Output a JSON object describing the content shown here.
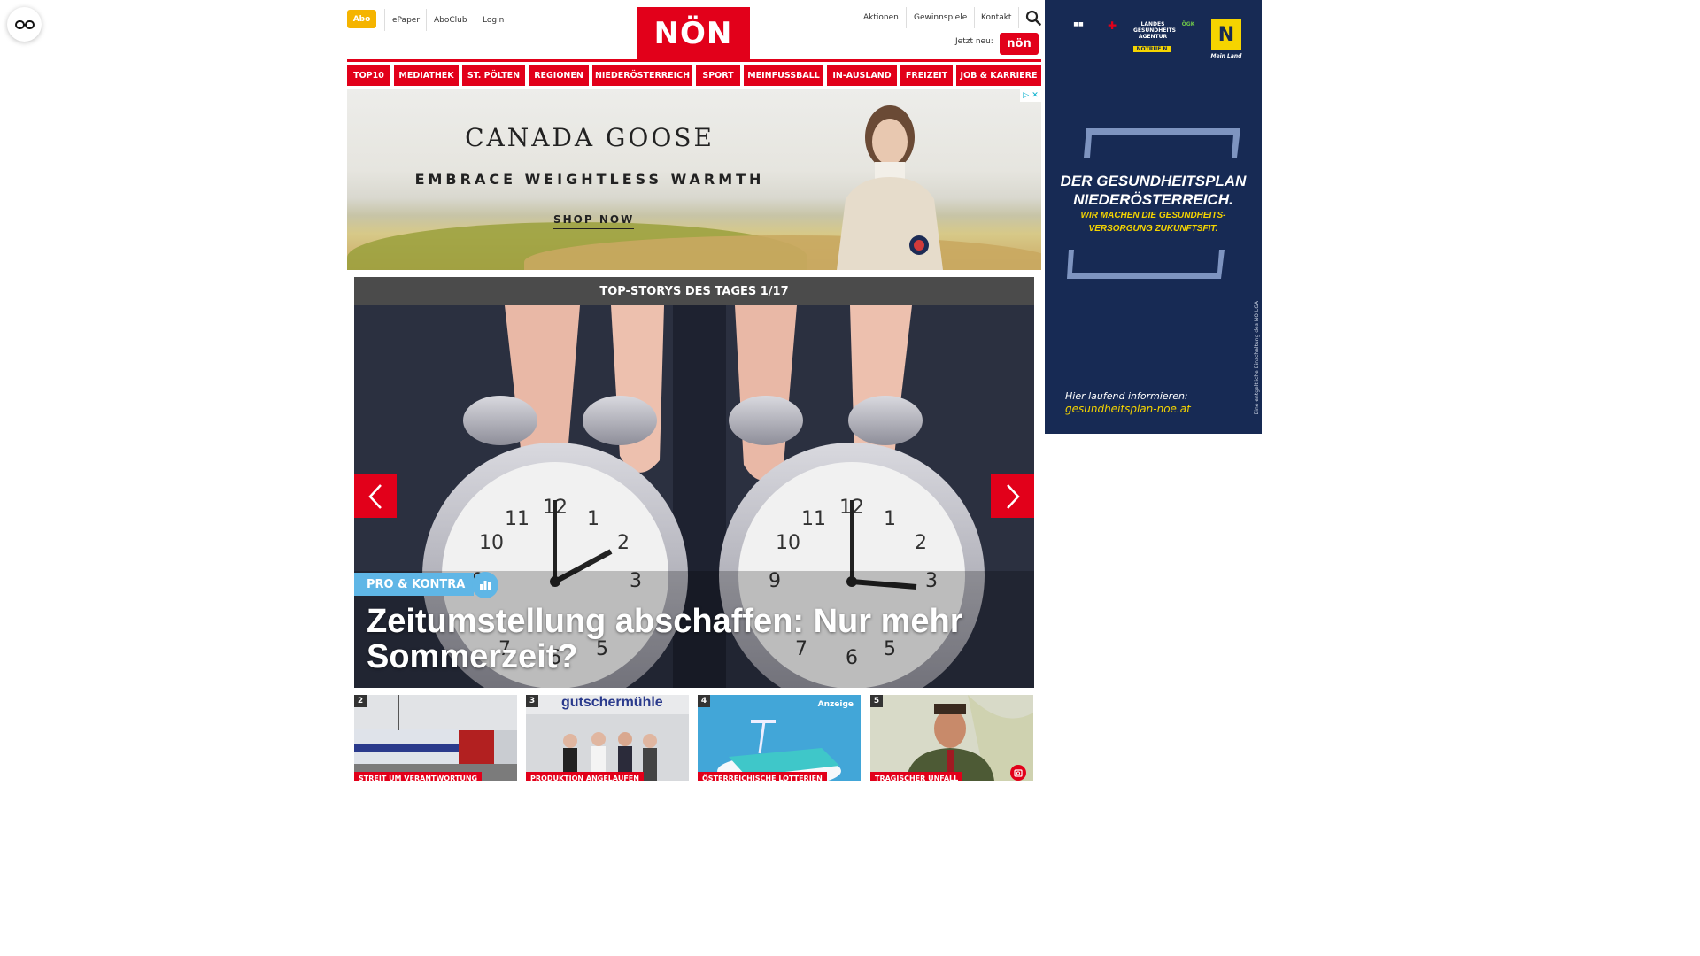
{
  "a11y": {
    "icon": "accessibility-glasses-icon"
  },
  "header": {
    "abo": "Abo",
    "links": [
      "ePaper",
      "AboClub",
      "Login"
    ],
    "logo": "NÖN",
    "right_links": [
      "Aktionen",
      "Gewinnspiele",
      "Kontakt"
    ],
    "jetzt_label": "Jetzt neu:",
    "jetzt_badge": "nön",
    "search_icon": "search-icon"
  },
  "nav": {
    "items": [
      "TOP10",
      "MEDIATHEK",
      "ST. PÖLTEN",
      "REGIONEN",
      "NIEDERÖSTERREICH",
      "SPORT",
      "MEINFUSSBALL",
      "IN-AUSLAND",
      "FREIZEIT",
      "JOB & KARRIERE"
    ]
  },
  "ad_top": {
    "brand": "CANADA GOOSE",
    "tagline": "EMBRACE WEIGHTLESS WARMTH",
    "cta": "SHOP NOW"
  },
  "slider": {
    "heading": "TOP-STORYS DES TAGES 1/17",
    "kicker": "PRO & KONTRA",
    "title": "Zeitumstellung abschaffen: Nur mehr Sommerzeit?"
  },
  "thumbs": [
    {
      "num": "2",
      "tag": "STREIT UM VERANTWORTUNG"
    },
    {
      "num": "3",
      "tag": "PRODUKTION ANGELAUFEN",
      "sign": "gutschermühle"
    },
    {
      "num": "4",
      "tag": "ÖSTERREICHISCHE LOTTERIEN",
      "badge": "Anzeige"
    },
    {
      "num": "5",
      "tag": "TRAGISCHER UNFALL"
    }
  ],
  "ad_sky": {
    "title_line1": "DER GESUNDHEITSPLAN",
    "title_line2": "NIEDERÖSTERREICH.",
    "sub_line1": "WIR MACHEN DIE GESUNDHEITS-",
    "sub_line2": "VERSORGUNG ZUKUNFTSFIT.",
    "info": "Hier laufend informieren:",
    "url": "gesundheitsplan-noe.at",
    "vertical": "Eine entgeltliche Einschaltung des NÖ LGA",
    "logos": [
      "LANDES GESUNDHEITS AGENTUR",
      "ÖGK",
      "NOTRUF N",
      "Mein Land"
    ]
  },
  "colors": {
    "brand_red": "#e2001a",
    "abo_yellow": "#f5b400",
    "sky_blue": "#172a54",
    "kicker_blue": "#5fb6e6"
  }
}
